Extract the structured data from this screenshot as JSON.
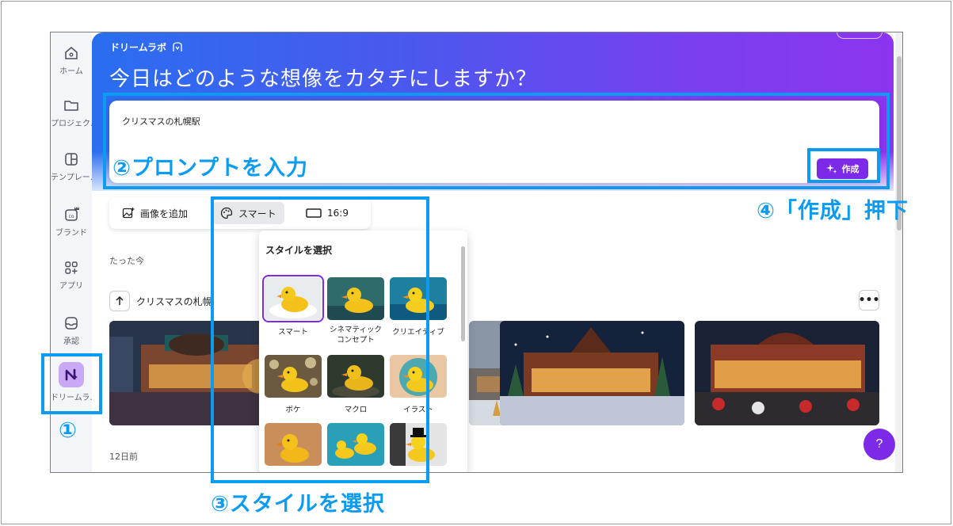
{
  "app": {
    "brand": "ドリームラボ",
    "headline": "今日はどのような想像をカタチにしますか？"
  },
  "sidebar": {
    "items": [
      {
        "label": "ホーム",
        "icon": "home-icon"
      },
      {
        "label": "プロジェク…",
        "icon": "folder-icon"
      },
      {
        "label": "テンプレー…",
        "icon": "template-icon"
      },
      {
        "label": "ブランド",
        "icon": "brand-icon"
      },
      {
        "label": "アプリ",
        "icon": "apps-icon"
      },
      {
        "label": "承認",
        "icon": "approval-icon"
      },
      {
        "label": "ドリームラ…",
        "icon": "dreamlab-icon"
      }
    ]
  },
  "prompt": {
    "value": "クリスマスの札幌駅",
    "create_label": "作成"
  },
  "toolbar": {
    "add_image": "画像を追加",
    "style": "スマート",
    "ratio": "16:9"
  },
  "history": {
    "recent_label": "たった今",
    "prompt_label": "クリスマスの札幌",
    "older_label": "12日前",
    "more": "•••"
  },
  "style_panel": {
    "title": "スタイルを選択",
    "styles": [
      {
        "label": "スマート",
        "selected": true
      },
      {
        "label": "シネマティック コンセプト",
        "selected": false
      },
      {
        "label": "クリエイティブ",
        "selected": false
      },
      {
        "label": "ボケ",
        "selected": false
      },
      {
        "label": "マクロ",
        "selected": false
      },
      {
        "label": "イラスト",
        "selected": false
      }
    ]
  },
  "help": "?",
  "annotations": {
    "step1": "①",
    "step2": "②プロンプトを入力",
    "step3": "③スタイルを選択",
    "step4": "④「作成」押下"
  },
  "colors": {
    "accent": "#7d2ae8",
    "annotation": "#0b9cf2"
  }
}
